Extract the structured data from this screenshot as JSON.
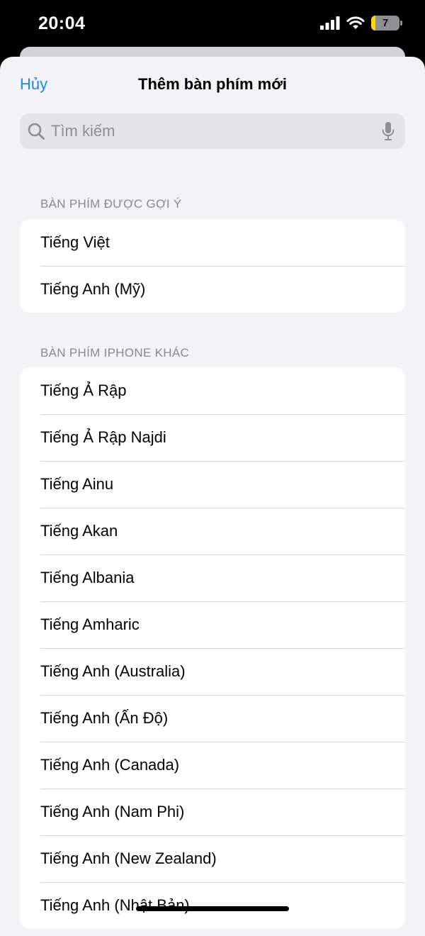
{
  "status_bar": {
    "time": "20:04",
    "battery_level": "7",
    "icons": [
      "cellular-signal-icon",
      "wifi-icon",
      "battery-icon"
    ]
  },
  "nav": {
    "cancel_label": "Hủy",
    "title": "Thêm bàn phím mới"
  },
  "search": {
    "placeholder": "Tìm kiếm",
    "value": ""
  },
  "sections": {
    "suggested": {
      "header": "BÀN PHÍM ĐƯỢC GỢI Ý",
      "items": [
        "Tiếng Việt",
        "Tiếng Anh (Mỹ)"
      ]
    },
    "other": {
      "header": "BÀN PHÍM IPHONE KHÁC",
      "items": [
        "Tiếng Ả Rập",
        "Tiếng Ả Rập Najdi",
        "Tiếng Ainu",
        "Tiếng Akan",
        "Tiếng Albania",
        "Tiếng Amharic",
        "Tiếng Anh (Australia)",
        "Tiếng Anh (Ấn Độ)",
        "Tiếng Anh (Canada)",
        "Tiếng Anh (Nam Phi)",
        "Tiếng Anh (New Zealand)",
        "Tiếng Anh (Nhật Bản)"
      ]
    }
  },
  "colors": {
    "accent": "#1e88e5",
    "background": "#f2f2f7",
    "card": "#ffffff",
    "secondary_text": "#8a8a8e"
  }
}
